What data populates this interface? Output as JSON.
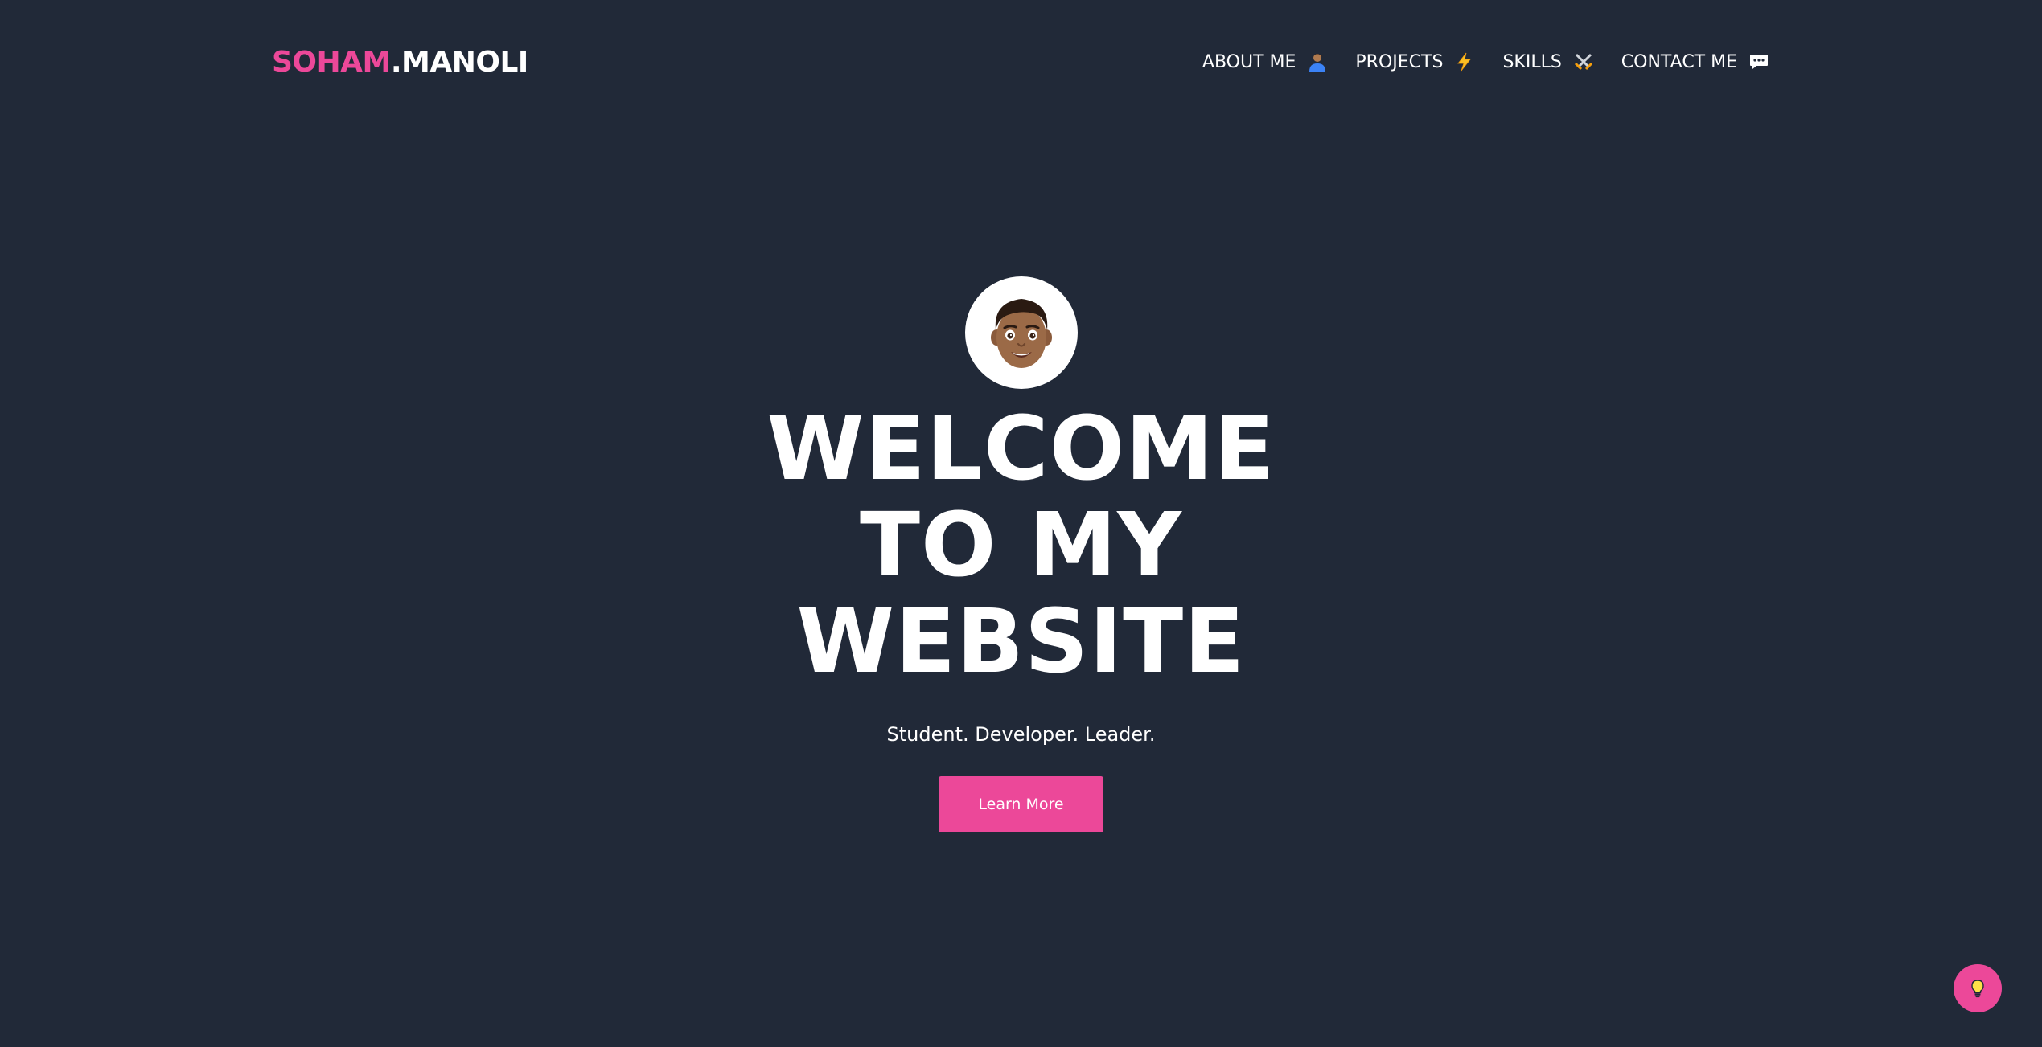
{
  "header": {
    "logo_first": "SOHAM",
    "logo_rest": ".MANOLI",
    "nav": [
      {
        "label": "ABOUT ME",
        "icon": "person-icon"
      },
      {
        "label": "PROJECTS",
        "icon": "lightning-icon"
      },
      {
        "label": "SKILLS",
        "icon": "crossed-swords-icon"
      },
      {
        "label": "CONTACT ME",
        "icon": "speech-bubble-icon"
      }
    ]
  },
  "hero": {
    "avatar_icon": "memoji-avatar-icon",
    "headline_line1": "WELCOME",
    "headline_line2": "TO MY",
    "headline_line3": "WEBSITE",
    "tagline": "Student. Developer. Leader.",
    "cta_label": "Learn More"
  },
  "fab": {
    "icon": "lightbulb-icon"
  },
  "colors": {
    "background": "#212938",
    "accent": "#ec4899",
    "text": "#ffffff"
  }
}
